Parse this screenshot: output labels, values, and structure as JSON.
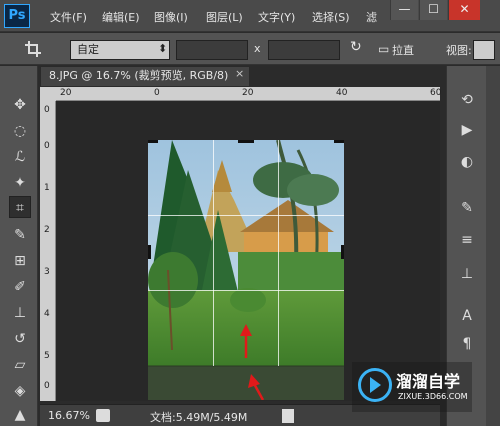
{
  "app": {
    "logo": "Ps"
  },
  "menu": [
    "文件(F)",
    "编辑(E)",
    "图像(I)",
    "图层(L)",
    "文字(Y)",
    "选择(S)",
    "滤"
  ],
  "window_controls": {
    "minimize": "—",
    "maximize": "☐",
    "close": "✕"
  },
  "options_bar": {
    "tool_icon": "crop-icon",
    "preset_value": "自定",
    "width_value": "",
    "height_value": "",
    "times_symbol": "x",
    "rotate_icon": "rotate-icon",
    "straighten_label": "拉直",
    "view_label": "视图:"
  },
  "document": {
    "tab_title": "8.JPG @ 16.7% (裁剪预览, RGB/8)",
    "tab_close": "×",
    "ruler_h_labels": [
      "20",
      "0",
      "20",
      "40",
      "60"
    ],
    "ruler_v_labels": [
      "0",
      "0",
      "1",
      "2",
      "3",
      "4",
      "5",
      "0"
    ]
  },
  "status_bar": {
    "zoom": "16.67%",
    "doc_info": "文档:5.49M/5.49M"
  },
  "watermark": {
    "title": "溜溜自学",
    "subtitle": "ZIXUE.3D66.COM"
  },
  "colors": {
    "accent_blue": "#31a8ff",
    "arrow_red": "#e01a1a",
    "crop_overlay": "#3a3a3a"
  }
}
